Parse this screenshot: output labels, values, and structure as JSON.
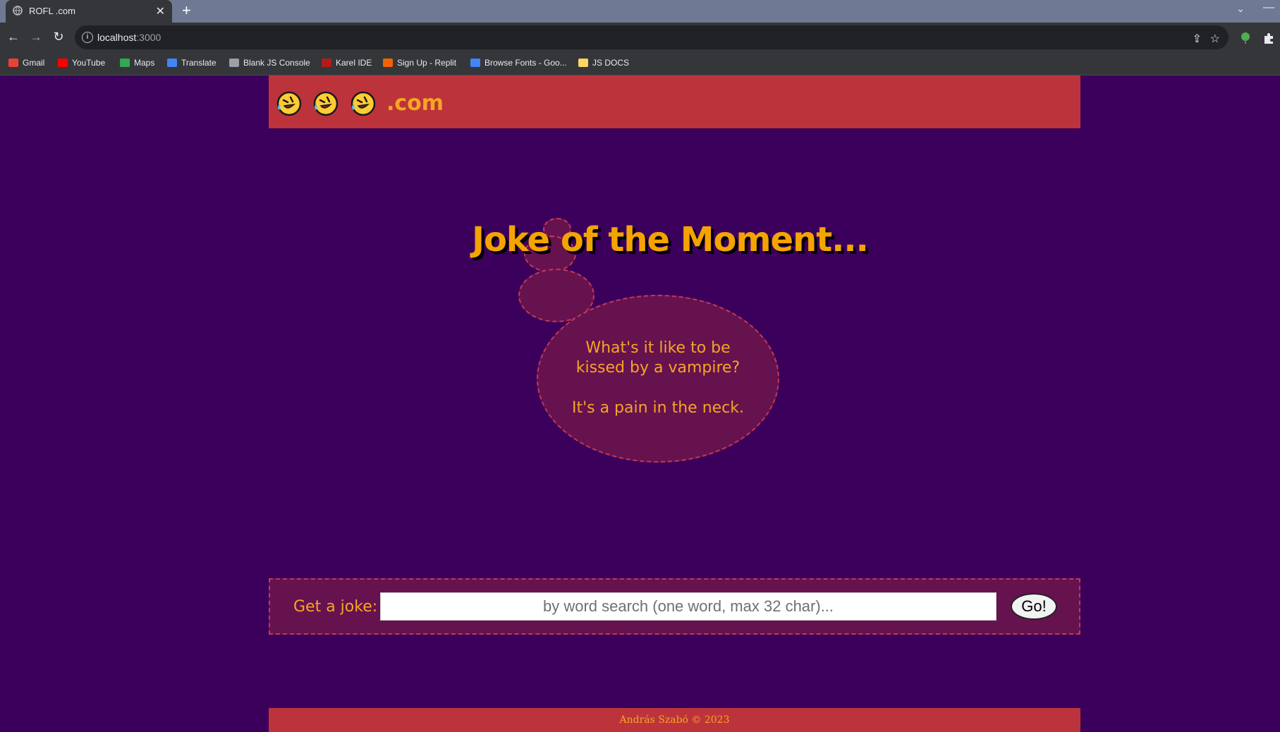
{
  "browser": {
    "tab_title": "ROFL .com",
    "new_tab": "+",
    "url_host": "localhost",
    "url_port": ":3000"
  },
  "bookmarks": [
    {
      "label": "Gmail",
      "color": "#ea4335"
    },
    {
      "label": "YouTube",
      "color": "#ff0000"
    },
    {
      "label": "Maps",
      "color": "#34a853"
    },
    {
      "label": "Translate",
      "color": "#4285f4"
    },
    {
      "label": "Blank JS Console",
      "color": "#9aa0a6"
    },
    {
      "label": "Karel IDE",
      "color": "#b31b1b"
    },
    {
      "label": "Sign Up - Replit",
      "color": "#f26207"
    },
    {
      "label": "Browse Fonts - Goo...",
      "color": "#4285f4"
    },
    {
      "label": "JS DOCS",
      "color": "#fdd663"
    }
  ],
  "header": {
    "logo_icons": [
      "rofl-icon",
      "rofl-icon",
      "rofl-icon"
    ],
    "logo_suffix": ".com"
  },
  "main": {
    "title": "Joke of the Moment...",
    "joke_question": "What's it like to be kissed by a vampire?",
    "joke_answer": "It's a pain in the neck."
  },
  "search": {
    "label": "Get a joke:",
    "placeholder": "by word search (one word, max 32 char)...",
    "value": "",
    "button_label": "Go!"
  },
  "footer": {
    "text": "András Szabó © 2023"
  },
  "colors": {
    "background": "#3b005c",
    "header_bar": "#bd333b",
    "accent_text": "#f5a623",
    "bubble_fill": "#66124f",
    "bubble_border": "#c23a55"
  }
}
